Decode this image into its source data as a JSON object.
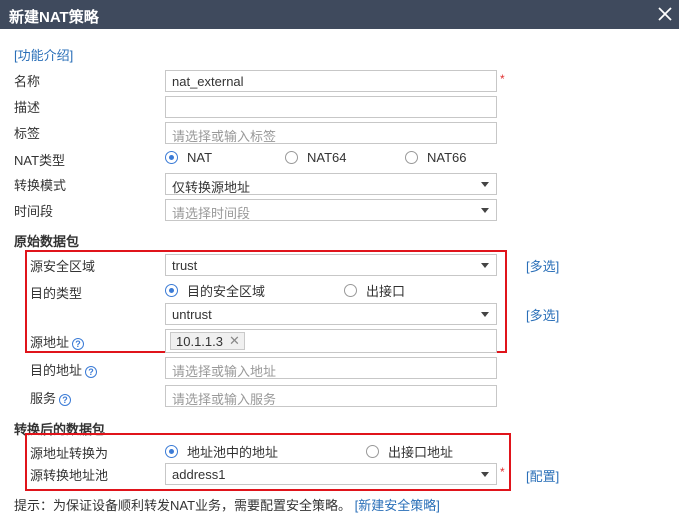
{
  "dialog": {
    "title": "新建NAT策略",
    "close_icon": "close-icon"
  },
  "intro_link": "[功能介绍]",
  "fields": {
    "name": {
      "label": "名称",
      "value": "nat_external",
      "required": "*"
    },
    "description": {
      "label": "描述",
      "value": ""
    },
    "tags": {
      "label": "标签",
      "placeholder": "请选择或输入标签"
    },
    "nat_type": {
      "label": "NAT类型",
      "options": [
        "NAT",
        "NAT64",
        "NAT66"
      ],
      "selected": "NAT"
    },
    "convert_mode": {
      "label": "转换模式",
      "value": "仅转换源地址"
    },
    "time_range": {
      "label": "时间段",
      "placeholder": "请选择时间段"
    }
  },
  "original_packet": {
    "title": "原始数据包",
    "src_zone": {
      "label": "源安全区域",
      "value": "trust",
      "link": "[多选]"
    },
    "dst_type": {
      "label": "目的类型",
      "options": [
        "目的安全区域",
        "出接口"
      ],
      "selected": "目的安全区域"
    },
    "dst_zone": {
      "value": "untrust",
      "link": "[多选]"
    },
    "src_addr": {
      "label": "源地址",
      "tag": "10.1.1.3"
    },
    "dst_addr": {
      "label": "目的地址",
      "placeholder": "请选择或输入地址"
    },
    "service": {
      "label": "服务",
      "placeholder": "请选择或输入服务"
    }
  },
  "translated_packet": {
    "title": "转换后的数据包",
    "src_translate": {
      "label": "源地址转换为",
      "options": [
        "地址池中的地址",
        "出接口地址"
      ],
      "selected": "地址池中的地址"
    },
    "pool": {
      "label": "源转换地址池",
      "value": "address1",
      "required": "*",
      "link": "[配置]"
    }
  },
  "tip": {
    "text": "提示：为保证设备顺利转发NAT业务，需要配置安全策略。",
    "link": "[新建安全策略]"
  },
  "colors": {
    "titlebar": "#3f4a5d",
    "link": "#2a6fb8",
    "highlight": "#e0141b",
    "radio_on": "#3b7bd6"
  }
}
